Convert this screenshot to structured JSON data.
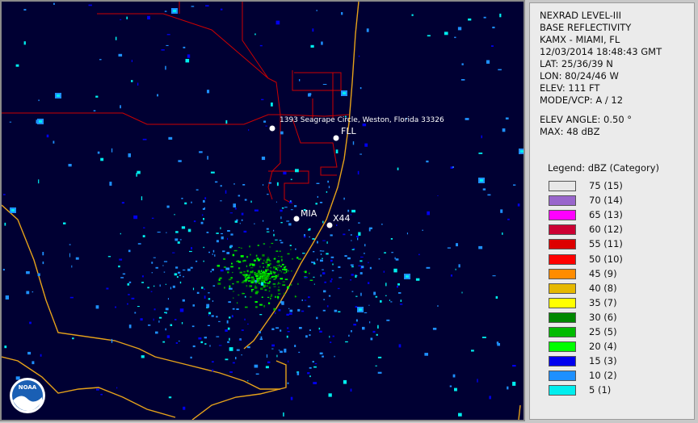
{
  "info": {
    "lines": [
      "NEXRAD LEVEL-III",
      "BASE REFLECTIVITY",
      "KAMX - MIAMI, FL",
      "12/03/2014 18:48:43 GMT",
      "LAT: 25/36/39 N",
      "LON: 80/24/46 W",
      "ELEV: 111 FT",
      "MODE/VCP: A / 12"
    ],
    "elev_angle": "ELEV ANGLE: 0.50 °",
    "max": "MAX: 48 dBZ"
  },
  "legend": {
    "title": "Legend: dBZ (Category)",
    "items": [
      {
        "label": "75  (15)",
        "color": "#e8e8e8"
      },
      {
        "label": "70  (14)",
        "color": "#9966cc"
      },
      {
        "label": "65  (13)",
        "color": "#ff00ff"
      },
      {
        "label": "60  (12)",
        "color": "#cc0033"
      },
      {
        "label": "55  (11)",
        "color": "#dd0000"
      },
      {
        "label": "50  (10)",
        "color": "#ff0000"
      },
      {
        "label": "45  (9)",
        "color": "#ff8c00"
      },
      {
        "label": "40  (8)",
        "color": "#e6b800"
      },
      {
        "label": "35  (7)",
        "color": "#ffff00"
      },
      {
        "label": "30  (6)",
        "color": "#008800"
      },
      {
        "label": "25  (5)",
        "color": "#00bb00"
      },
      {
        "label": "20  (4)",
        "color": "#00ff00"
      },
      {
        "label": "15  (3)",
        "color": "#0000ee"
      },
      {
        "label": "10  (2)",
        "color": "#1e90ff"
      },
      {
        "label": "5  (1)",
        "color": "#00eeee"
      }
    ]
  },
  "map": {
    "location_label": "1393 Seagrape Circle, Weston, Florida 33326",
    "airports": [
      "FLL",
      "MIA",
      "X44"
    ],
    "logo_text": "NOAA",
    "colors": {
      "background": "#000033",
      "coastline": "#e6a21a",
      "county_lines": "#cc0000",
      "markers": "#ffffff"
    }
  }
}
